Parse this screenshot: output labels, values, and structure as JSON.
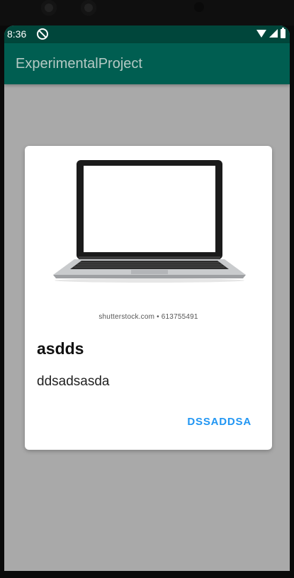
{
  "status_bar": {
    "time": "8:36"
  },
  "app_bar": {
    "title": "ExperimentalProject"
  },
  "card": {
    "image_icon": "laptop-image",
    "watermark": "shutterstock.com • 613755491",
    "title": "asdds",
    "body": "ddsadsasda",
    "action_label": "DSSADDSA"
  },
  "colors": {
    "status_bar": "#00463b",
    "app_bar": "#005e51",
    "background": "#a9a9a9",
    "card": "#ffffff",
    "action": "#2196f3"
  }
}
